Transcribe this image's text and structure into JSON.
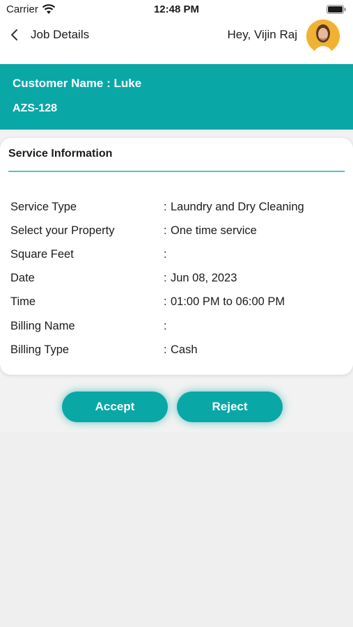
{
  "status_bar": {
    "carrier": "Carrier",
    "time": "12:48 PM"
  },
  "header": {
    "title": "Job Details",
    "greeting": "Hey, Vijin Raj"
  },
  "banner": {
    "customer_name": "Customer Name : Luke",
    "job_code": "AZS-128"
  },
  "service_info": {
    "title": "Service Information",
    "rows": [
      {
        "label": "Service Type",
        "sep": ":",
        "value": "Laundry and Dry Cleaning"
      },
      {
        "label": "Select your Property",
        "sep": ":",
        "value": "One time service"
      },
      {
        "label": "Square Feet",
        "sep": ":",
        "value": ""
      },
      {
        "label": "Date",
        "sep": ":",
        "value": "Jun 08, 2023"
      },
      {
        "label": "Time",
        "sep": ":",
        "value": "01:00 PM to 06:00 PM"
      },
      {
        "label": "Billing Name",
        "sep": ":",
        "value": ""
      },
      {
        "label": "Billing Type",
        "sep": ":",
        "value": "Cash"
      }
    ]
  },
  "actions": {
    "accept": "Accept",
    "reject": "Reject"
  },
  "colors": {
    "accent": "#0aa7a7",
    "background": "#f2f2f2"
  }
}
